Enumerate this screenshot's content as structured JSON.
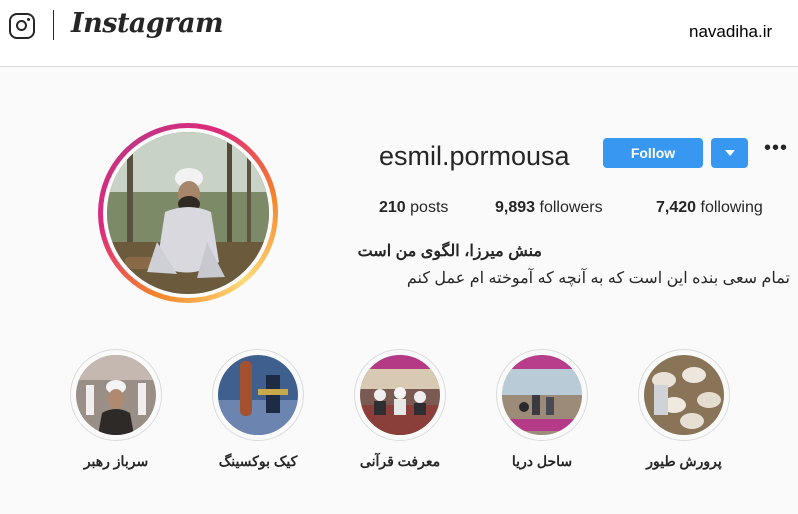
{
  "topbar": {
    "logo_text": "Instagram",
    "watermark": "navadiha.ir"
  },
  "profile": {
    "username": "esmil.pormousa",
    "follow_label": "Follow",
    "more_label": "•••",
    "stats": {
      "posts_count": "210",
      "posts_label": "posts",
      "followers_count": "9,893",
      "followers_label": "followers",
      "following_count": "7,420",
      "following_label": "following"
    },
    "bio_name": "منش میرزا، الگوی من است",
    "bio_text": "تمام سعی بنده این است که به آنچه که آموخته ام عمل کنم"
  },
  "highlights": [
    {
      "label": "سرباز رهبر"
    },
    {
      "label": "کیک بوکسینگ"
    },
    {
      "label": "معرفت قرآنی"
    },
    {
      "label": "ساحل دریا"
    },
    {
      "label": "پرورش طیور"
    }
  ],
  "colors": {
    "accent": "#3897f0",
    "background": "#fafafa",
    "text": "#262626"
  }
}
